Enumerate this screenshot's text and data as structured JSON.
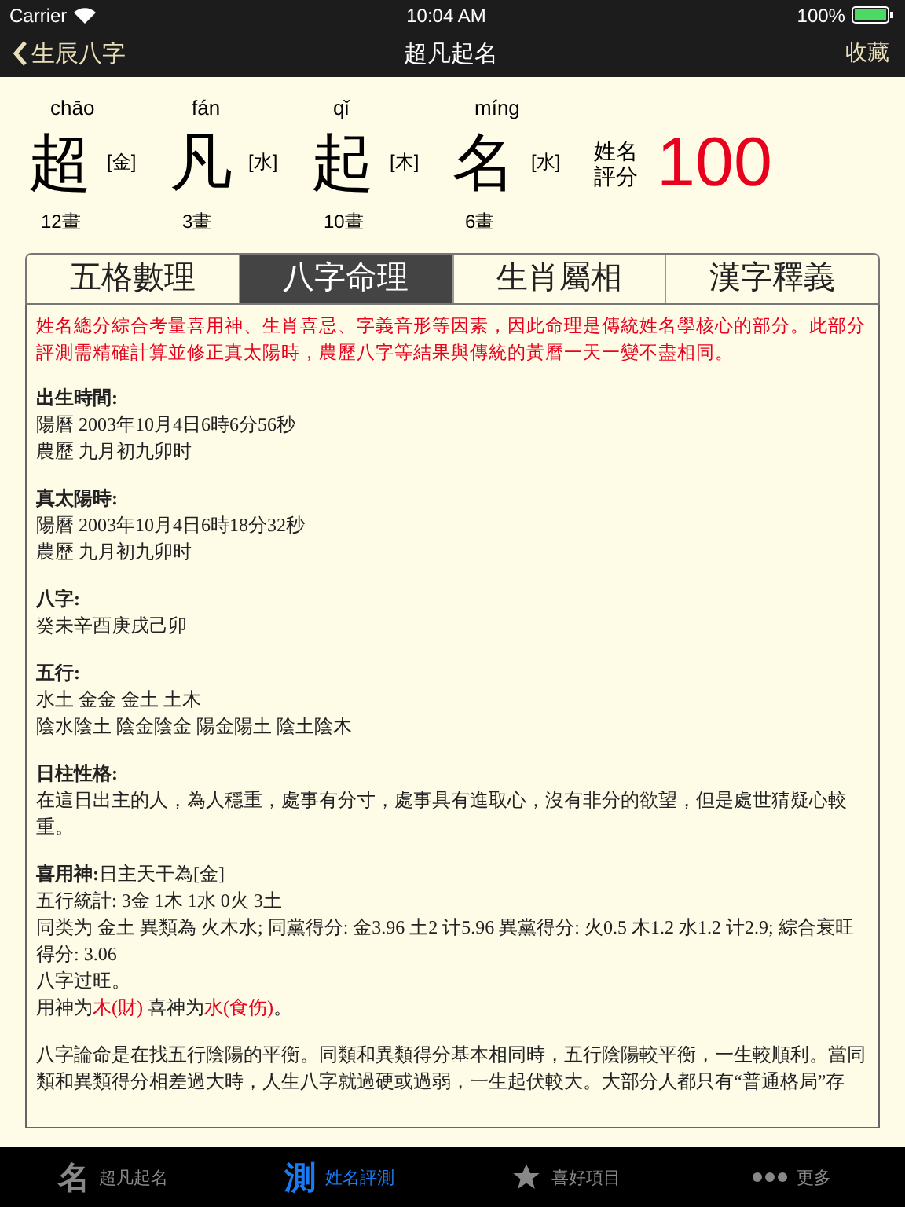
{
  "status_bar": {
    "carrier": "Carrier",
    "time": "10:04 AM",
    "battery": "100%"
  },
  "nav": {
    "back": "生辰八字",
    "title": "超凡起名",
    "action": "收藏"
  },
  "name_chars": [
    {
      "pinyin": "chāo",
      "char": "超",
      "element": "[金]",
      "strokes": "12畫"
    },
    {
      "pinyin": "fán",
      "char": "凡",
      "element": "[水]",
      "strokes": "3畫"
    },
    {
      "pinyin": "qǐ",
      "char": "起",
      "element": "[木]",
      "strokes": "10畫"
    },
    {
      "pinyin": "míng",
      "char": "名",
      "element": "[水]",
      "strokes": "6畫"
    }
  ],
  "score": {
    "label_lines": [
      "姓名",
      "評分"
    ],
    "value": "100"
  },
  "tabs": [
    {
      "label": "五格數理",
      "selected": false
    },
    {
      "label": "八字命理",
      "selected": true
    },
    {
      "label": "生肖屬相",
      "selected": false
    },
    {
      "label": "漢字釋義",
      "selected": false
    }
  ],
  "content": [
    {
      "kind": "note",
      "text": "姓名總分綜合考量喜用神、生肖喜忌、字義音形等因素，因此命理是傳統姓名學核心的部分。此部分評測需精確計算並修正真太陽時，農歷八字等結果與傳統的黃曆一天一變不盡相同。"
    },
    {
      "kind": "section",
      "heading": "出生時間:",
      "lines": [
        {
          "text": "陽曆 2003年10月4日6時6分56秒"
        },
        {
          "text": "農歷 九月初九卯时"
        }
      ]
    },
    {
      "kind": "section",
      "heading": "真太陽時:",
      "lines": [
        {
          "text": "陽曆 2003年10月4日6時18分32秒"
        },
        {
          "text": "農歷 九月初九卯时"
        }
      ]
    },
    {
      "kind": "section",
      "heading": "八字:",
      "lines": [
        {
          "text": "癸未辛酉庚戌己卯"
        }
      ]
    },
    {
      "kind": "section",
      "heading": "五行:",
      "lines": [
        {
          "text": "水土 金金 金土 土木"
        },
        {
          "text": "陰水陰土 陰金陰金 陽金陽土 陰土陰木"
        }
      ]
    },
    {
      "kind": "section",
      "heading": "日柱性格:",
      "lines": [
        {
          "text": "在這日出主的人，為人穩重，處事有分寸，處事具有進取心，沒有非分的欲望，但是處世猜疑心較重。"
        }
      ]
    },
    {
      "kind": "section",
      "lines": [
        {
          "text": "**喜用神:**日主天干為[金]"
        },
        {
          "text": "五行統計: 3金 1木 1水 0火 3土"
        },
        {
          "text": "同类为 金土 異類為 火木水; 同黨得分: 金3.96 土2 计5.96 異黨得分: 火0.5 木1.2 水1.2 计2.9; 綜合衰旺得分: 3.06"
        },
        {
          "text": "八字过旺。"
        },
        {
          "segments": [
            {
              "text": "用神为",
              "highlight": false
            },
            {
              "text": "木(財)",
              "highlight": true
            },
            {
              "text": " 喜神为",
              "highlight": false
            },
            {
              "text": "水(食伤)",
              "highlight": true
            },
            {
              "text": "。",
              "highlight": false
            }
          ]
        }
      ]
    },
    {
      "kind": "section",
      "lines": [
        {
          "text": "八字論命是在找五行陰陽的平衡。同類和異類得分基本相同時，五行陰陽較平衡，一生較順利。當同類和異類得分相差過大時，人生八字就過硬或過弱，一生起伏較大。大部分人都只有“普通格局”存"
        }
      ]
    }
  ],
  "tab_bar": [
    {
      "kind": "glyph",
      "glyph": "名",
      "label": "超凡起名",
      "selected": false
    },
    {
      "kind": "glyph",
      "glyph": "測",
      "label": "姓名評測",
      "selected": true
    },
    {
      "kind": "star",
      "label": "喜好項目",
      "selected": false
    },
    {
      "kind": "dots",
      "label": "更多",
      "selected": false
    }
  ]
}
